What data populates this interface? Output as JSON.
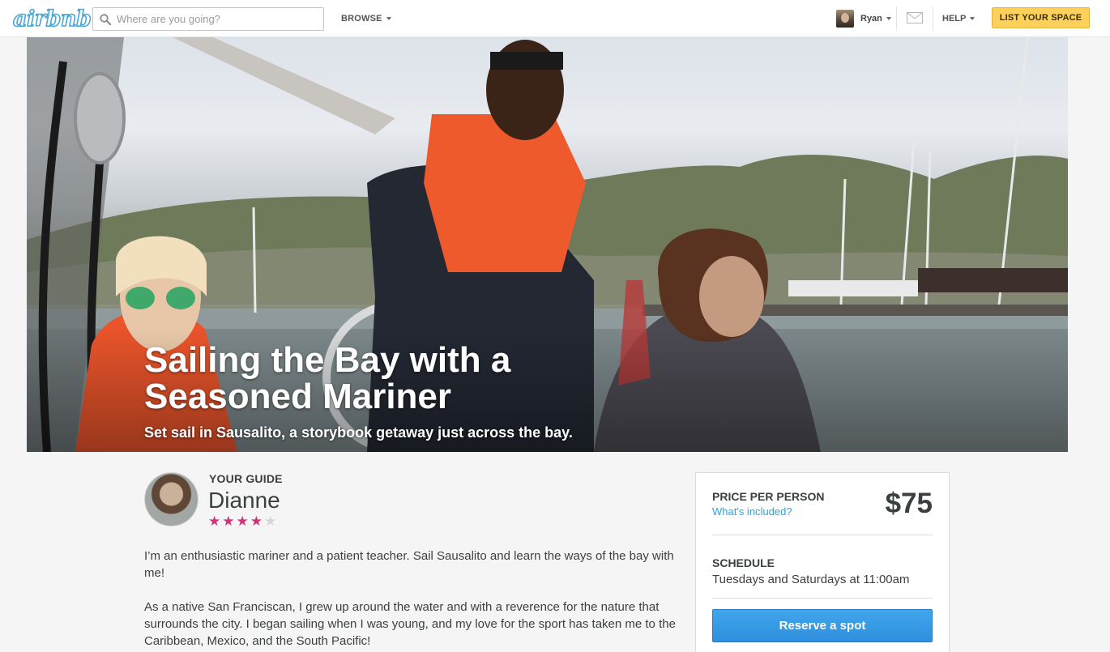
{
  "header": {
    "logo_text": "airbnb",
    "search_placeholder": "Where are you going?",
    "browse_label": "BROWSE",
    "user_name": "Ryan",
    "help_label": "HELP",
    "list_space_label": "LIST YOUR SPACE"
  },
  "hero": {
    "title": "Sailing the Bay with a Seasoned Mariner",
    "subtitle": "Set sail in Sausalito, a storybook getaway just across the bay."
  },
  "guide": {
    "label": "YOUR GUIDE",
    "name": "Dianne",
    "rating": 4,
    "rating_max": 5
  },
  "bio": {
    "paragraphs": [
      "I’m an enthusiastic mariner and a patient teacher. Sail Sausalito and learn the ways of the bay with me!",
      "As a native San Franciscan, I grew up around the water and with a reverence for the nature that surrounds the city. I began sailing when I was young, and my love for the sport has taken me to the Caribbean, Mexico, and the South Pacific!"
    ]
  },
  "booking": {
    "price_label": "PRICE PER PERSON",
    "included_link": "What's included?",
    "price": "$75",
    "schedule_label": "SCHEDULE",
    "schedule_value": "Tuesdays and Saturdays at 11:00am",
    "reserve_label": "Reserve a spot"
  },
  "colors": {
    "brand_blue": "#4aa8d8",
    "accent_yellow": "#fcd05a",
    "star_pink": "#d4307b",
    "link_blue": "#2aa5de",
    "button_blue": "#3a9be6"
  }
}
